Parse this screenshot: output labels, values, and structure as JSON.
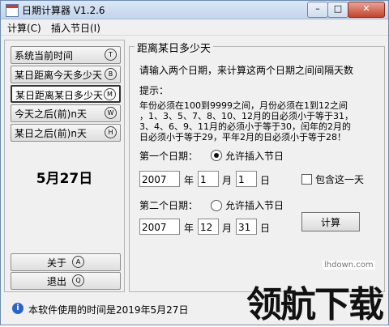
{
  "window": {
    "title": "日期计算器  V1.2.6",
    "controls": {
      "minimize": "–",
      "maximize": "□",
      "close": "✕"
    }
  },
  "menu": [
    "计算(C)",
    "插入节日(I)"
  ],
  "left_buttons": [
    {
      "label": "系统当前时间",
      "hotkey": "T"
    },
    {
      "label": "某日距离今天多少天",
      "hotkey": "B"
    },
    {
      "label": "某日距离某日多少天",
      "hotkey": "M"
    },
    {
      "label": "今天之后(前)n天",
      "hotkey": "W"
    },
    {
      "label": "某日之后(前)n天",
      "hotkey": "H"
    }
  ],
  "current_date": "5月27日",
  "bottom_buttons": [
    {
      "label": "关于",
      "hotkey": "A"
    },
    {
      "label": "退出",
      "hotkey": "Q"
    }
  ],
  "group": {
    "title": "距离某日多少天",
    "instruction": "请输入两个日期，来计算这两个日期之间间隔天数",
    "tip_title": "提示：",
    "tip_lines": [
      "年份必须在100到9999之间，月份必须在1到12之间",
      "，1、3、5、7、8、10、12月的日必须小于等于31，",
      "3、4、6、9、11月的必须小于等于30，闰年的2月的",
      "日必须小于等于29，平年2月的日必须小于等于28！"
    ],
    "date1": {
      "label": "第一个日期：",
      "allow_holiday": "允许插入节日",
      "allow_checked": true,
      "year": "2007",
      "month": "1",
      "day": "1"
    },
    "date2": {
      "label": "第二个日期：",
      "allow_holiday": "允许插入节日",
      "allow_checked": false,
      "year": "2007",
      "month": "12",
      "day": "31"
    },
    "units": {
      "year": "年",
      "month": "月",
      "day": "日"
    },
    "include_day": "包含这一天",
    "include_checked": false,
    "calculate": "计算"
  },
  "status": "本软件使用的时间是2019年5月27日",
  "watermark": {
    "url": "lhdown.com",
    "text": "领航下载"
  }
}
